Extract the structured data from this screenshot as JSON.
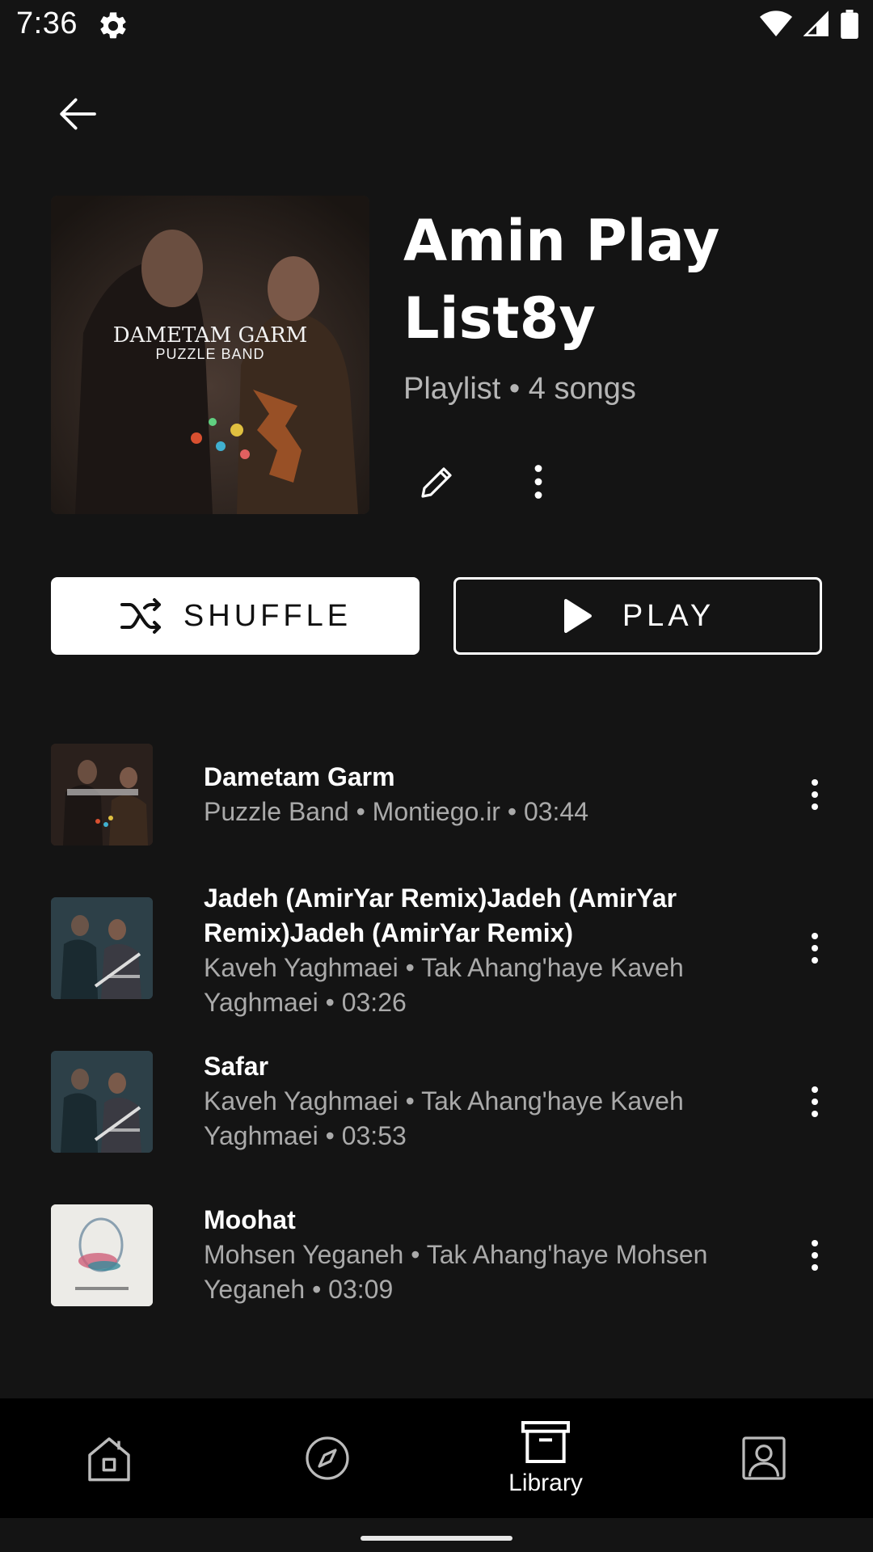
{
  "status_bar": {
    "time": "7:36",
    "icons": [
      "gear-icon",
      "wifi-icon",
      "signal-icon",
      "battery-icon"
    ]
  },
  "header": {
    "back_icon": "arrow-left-icon"
  },
  "playlist": {
    "title": "Amin Play List8y",
    "subtitle": "Playlist • 4 songs",
    "cover_text_line1": "DAMETAM GARM",
    "cover_text_line2": "PUZZLE BAND",
    "edit_icon": "pencil-icon",
    "more_icon": "more-vert-icon"
  },
  "actions": {
    "shuffle_label": "SHUFFLE",
    "play_label": "PLAY"
  },
  "songs": [
    {
      "title": "Dametam Garm",
      "subtitle": "Puzzle Band • Montiego.ir  • 03:44",
      "thumb_color": "#3a2a22"
    },
    {
      "title": "Jadeh (AmirYar Remix)Jadeh (AmirYar Remix)Jadeh (AmirYar Remix)",
      "subtitle": "Kaveh Yaghmaei • Tak Ahang'haye Kaveh Yaghmaei • 03:26",
      "thumb_color": "#2d4048"
    },
    {
      "title": "Safar",
      "subtitle": "Kaveh Yaghmaei  • Tak Ahang'haye Kaveh Yaghmaei  • 03:53",
      "thumb_color": "#2d4048"
    },
    {
      "title": "Moohat",
      "subtitle": "Mohsen Yeganeh • Tak Ahang'haye Mohsen Yeganeh • 03:09",
      "thumb_color": "#e8e6e2"
    }
  ],
  "bottom_nav": {
    "items": [
      {
        "icon": "home-icon",
        "label": ""
      },
      {
        "icon": "explore-icon",
        "label": ""
      },
      {
        "icon": "library-icon",
        "label": "Library",
        "active": true
      },
      {
        "icon": "account-icon",
        "label": ""
      }
    ]
  },
  "colors": {
    "background": "#141414",
    "nav_background": "#000000",
    "text_primary": "#ffffff",
    "text_secondary": "#aaaaaa"
  }
}
